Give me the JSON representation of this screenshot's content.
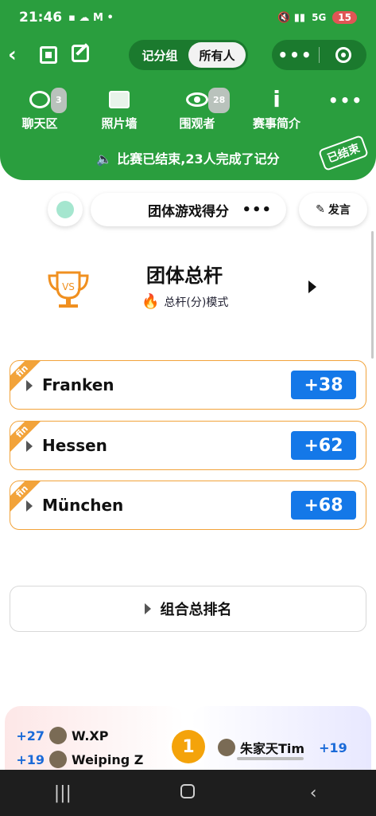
{
  "status": {
    "time": "21:46",
    "battery": "15",
    "network": "5G"
  },
  "nav": {
    "segments": [
      "记分组",
      "所有人"
    ],
    "active_segment": 1
  },
  "icons": [
    {
      "label": "聊天区",
      "badge": "3",
      "icon": "chat-bubble-icon"
    },
    {
      "label": "照片墙",
      "badge": "",
      "icon": "photo-icon"
    },
    {
      "label": "围观者",
      "badge": "28",
      "icon": "eye-icon"
    },
    {
      "label": "赛事简介",
      "badge": "",
      "icon": "info-icon"
    }
  ],
  "announcement": "比赛已结束,23人完成了记分",
  "stamp": "已结束",
  "toolbar": {
    "title": "团体游戏得分",
    "speak": "发言"
  },
  "summary": {
    "title": "团体总杆",
    "mode": "总杆(分)模式"
  },
  "teams": [
    {
      "tag": "fin",
      "name": "Franken",
      "score": "+38"
    },
    {
      "tag": "fin",
      "name": "Hessen",
      "score": "+62"
    },
    {
      "tag": "fin",
      "name": "München",
      "score": "+68"
    }
  ],
  "combo_label": "组合总排名",
  "ranking": {
    "position": "1",
    "left_players": [
      {
        "score": "+27",
        "name": "W.XP"
      },
      {
        "score": "+19",
        "name": "Weiping Z"
      }
    ],
    "right_player": {
      "name": "朱家天Tim",
      "score": "+19"
    }
  },
  "colors": {
    "header": "#2a9e3e",
    "score_bg": "#1478e8",
    "fin_tag": "#f2a33a",
    "rank_badge": "#f4a30a"
  }
}
